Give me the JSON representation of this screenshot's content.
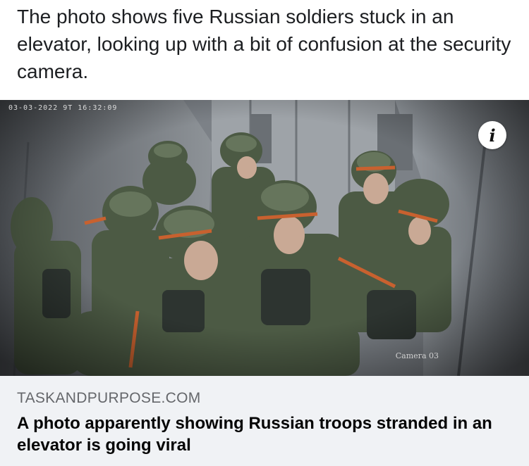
{
  "post": {
    "caption": "The photo shows five Russian soldiers stuck in an elevator, looking up with a bit of confusion at the security camera."
  },
  "media": {
    "camera_timestamp": "03-03-2022 9T 16:32:09",
    "camera_label": "Camera 03",
    "info_icon": "info-icon"
  },
  "link_card": {
    "domain": "TASKANDPURPOSE.COM",
    "title": "A photo apparently showing Russian troops stranded in an elevator is going viral"
  },
  "colors": {
    "card_background": "#f0f2f5",
    "domain_text": "#65676b",
    "title_text": "#050505"
  }
}
